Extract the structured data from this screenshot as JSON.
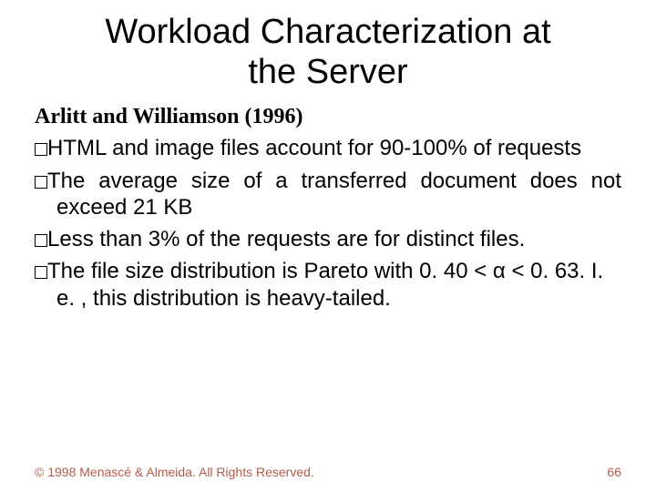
{
  "title_line1": "Workload Characterization at",
  "title_line2": "the Server",
  "subtitle": "Arlitt and Williamson (1996)",
  "bullets": [
    "HTML and image files account for 90-100% of requests",
    "The average size of a transferred document does not exceed 21 KB",
    "Less than 3% of the requests are for distinct files.",
    "The file size distribution is Pareto with 0. 40 < α < 0. 63.  I. e. , this distribution is heavy-tailed."
  ],
  "footer_left": "© 1998 Menascé & Almeida. All Rights Reserved.",
  "footer_right": "66"
}
